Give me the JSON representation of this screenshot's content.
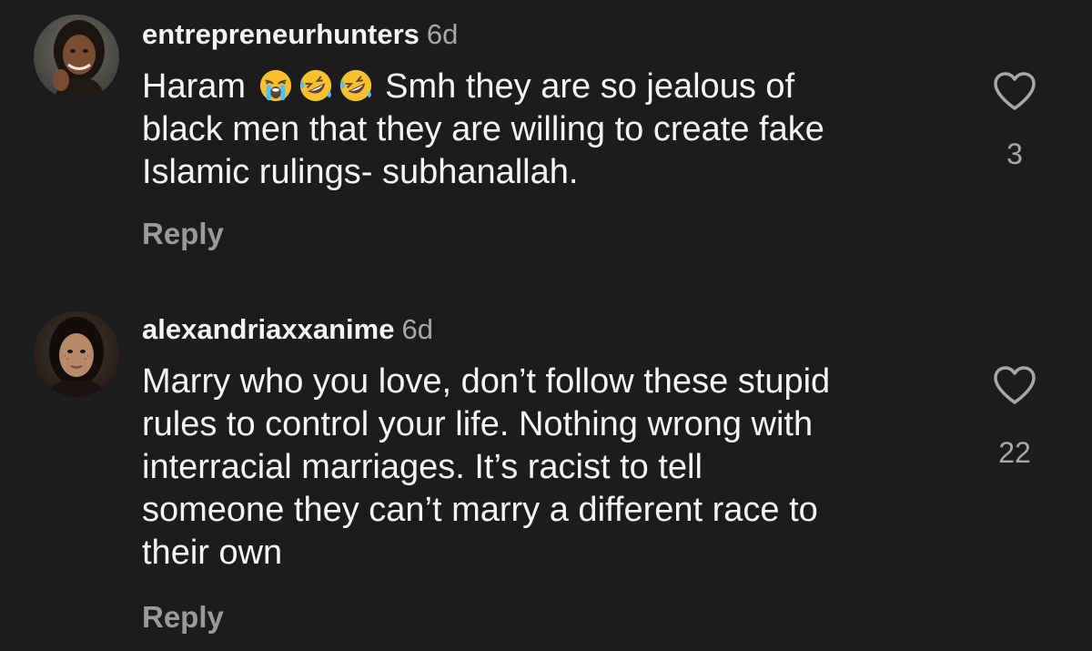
{
  "comments": [
    {
      "username": "entrepreneurhunters",
      "time": "6d",
      "lines": [
        {
          "before": "Haram",
          "emoji": [
            "loudly-crying-face",
            "rolling-on-floor-laughing",
            "rolling-on-floor-laughing"
          ],
          "after": "Smh they are so jealous of"
        },
        {
          "text": "black men that they are willing to create fake"
        },
        {
          "text": "Islamic rulings- subhanallah."
        }
      ],
      "likes": "3",
      "reply_label": "Reply"
    },
    {
      "username": "alexandriaxxanime",
      "time": "6d",
      "lines": [
        {
          "text": "Marry who you love, don’t follow these stupid"
        },
        {
          "text": "rules to control your life. Nothing wrong with"
        },
        {
          "text": "interracial marriages. It’s racist to tell"
        },
        {
          "text": "someone they can’t marry a different race to"
        },
        {
          "text": "their own"
        }
      ],
      "likes": "22",
      "reply_label": "Reply"
    }
  ],
  "colors": {
    "background": "#1c1c1e",
    "text": "#f5f5f5",
    "secondary": "#a8a8a8",
    "reply": "#9a9a9a"
  }
}
